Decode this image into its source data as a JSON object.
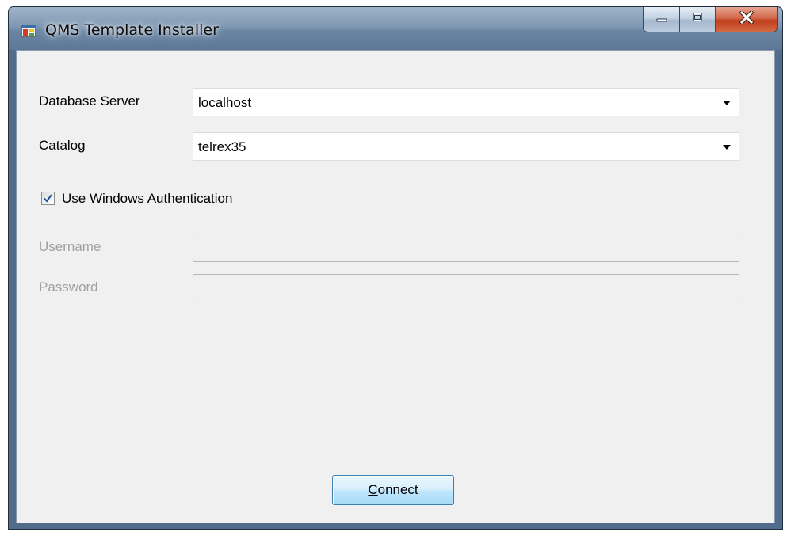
{
  "window": {
    "title": "QMS Template Installer",
    "icon": "app-window-icon"
  },
  "caption": {
    "minimize_icon": "minimize-icon",
    "maximize_icon": "maximize-icon",
    "close_icon": "close-icon"
  },
  "form": {
    "database_server": {
      "label": "Database Server",
      "value": "localhost"
    },
    "catalog": {
      "label": "Catalog",
      "value": "telrex35"
    },
    "windows_auth": {
      "label": "Use Windows Authentication",
      "checked": true
    },
    "username": {
      "label": "Username",
      "value": ""
    },
    "password": {
      "label": "Password",
      "value": ""
    },
    "connect": {
      "label_accel": "C",
      "label_rest": "onnect"
    }
  },
  "colors": {
    "accent": "#3c7fb1",
    "client_bg": "#f0f0f0",
    "disabled_text": "#a0a0a0"
  }
}
